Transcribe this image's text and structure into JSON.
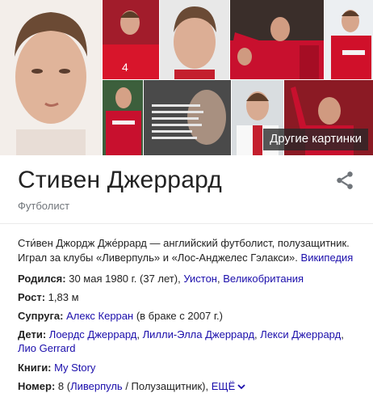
{
  "images": {
    "more_label": "Другие картинки",
    "tile_text": "",
    "tiles": [
      {
        "name": "portrait-main"
      },
      {
        "name": "photo-england-kit"
      },
      {
        "name": "photo-headshot"
      },
      {
        "name": "photo-liverpool-celebration"
      },
      {
        "name": "photo-liverpool-standard"
      },
      {
        "name": "photo-carlsberg-kit"
      },
      {
        "name": "photo-quote"
      },
      {
        "name": "photo-white-shirt"
      },
      {
        "name": "photo-captain"
      }
    ]
  },
  "entity": {
    "title": "Стивен Джеррард",
    "subtitle": "Футболист"
  },
  "description": {
    "text": "Сти́вен Джордж Дже́ррард — английский футболист, полузащитник. Играл за клубы «Ливерпуль» и «Лос-Анджелес Гэлакси».",
    "source_link": "Википедия"
  },
  "facts": {
    "born": {
      "label": "Родился:",
      "text": "30 мая 1980 г. (37 лет),",
      "link1": "Уистон",
      "sep": ",",
      "link2": "Великобритания"
    },
    "height": {
      "label": "Рост:",
      "text": "1,83 м"
    },
    "spouse": {
      "label": "Супруга:",
      "link": "Алекс Керран",
      "text": "(в браке с 2007 г.)"
    },
    "children": {
      "label": "Дети:",
      "links": [
        "Лоердс Джеррард",
        "Лилли-Элла Джеррард",
        "Лекси Джеррард",
        "Лио Gerrard"
      ],
      "sep": ","
    },
    "books": {
      "label": "Книги:",
      "link": "My Story"
    },
    "number": {
      "label": "Номер:",
      "text_pre": "8 (",
      "link1": "Ливерпуль",
      "text_mid": " / Полузащитник),",
      "more": "ЕЩЁ"
    }
  },
  "colors": {
    "link": "#1a0dab",
    "secondary_text": "#70757a",
    "liverpool_red": "#c8102e"
  },
  "icons": {
    "share": "share-icon",
    "more_chevron": "chevron-down-icon"
  }
}
